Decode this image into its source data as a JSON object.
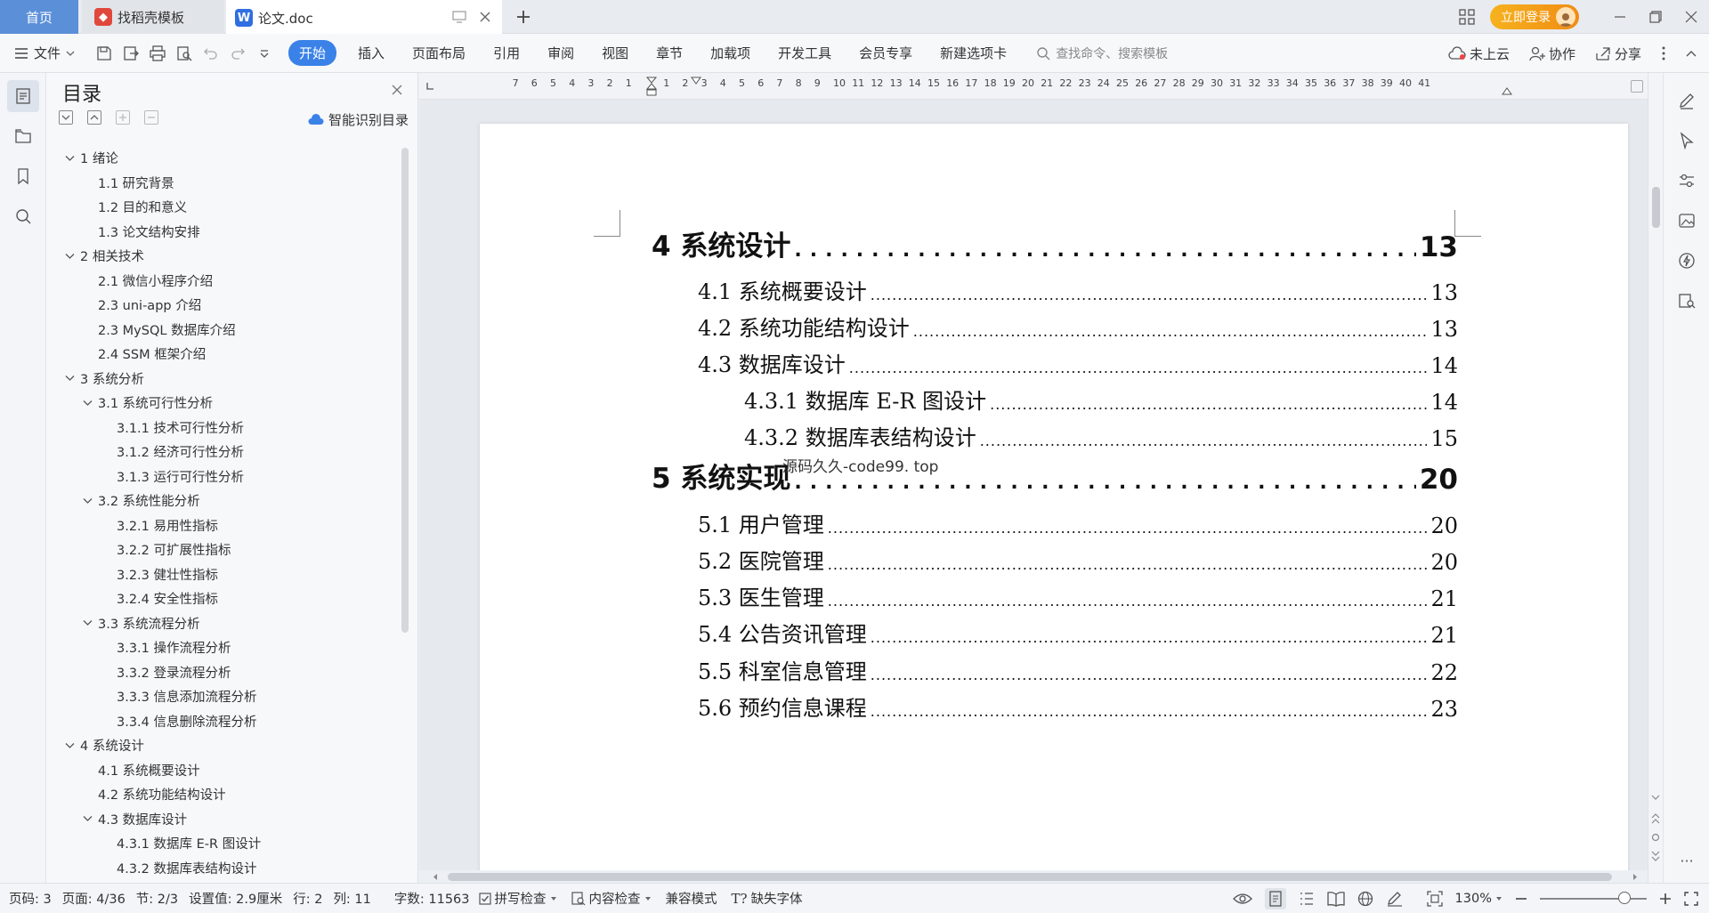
{
  "tabs": {
    "home": "首页",
    "template": "找稻壳模板",
    "doc": "论文.doc"
  },
  "titlebar": {
    "login": "立即登录"
  },
  "ribbon": {
    "file": "文件",
    "menu": [
      "开始",
      "插入",
      "页面布局",
      "引用",
      "审阅",
      "视图",
      "章节",
      "加载项",
      "开发工具",
      "会员专享",
      "新建选项卡"
    ],
    "search_placeholder": "查找命令、搜索模板",
    "cloud": "未上云",
    "collab": "协作",
    "share": "分享"
  },
  "toc_panel": {
    "title": "目录",
    "smart": "智能识别目录",
    "items": [
      {
        "level": 1,
        "text": "1  绪论",
        "expanded": true
      },
      {
        "level": 2,
        "text": "1.1  研究背景"
      },
      {
        "level": 2,
        "text": "1.2  目的和意义"
      },
      {
        "level": 2,
        "text": "1.3  论文结构安排"
      },
      {
        "level": 1,
        "text": "2  相关技术",
        "expanded": true
      },
      {
        "level": 2,
        "text": "2.1  微信小程序介绍"
      },
      {
        "level": 2,
        "text": "2.3 uni-app 介绍"
      },
      {
        "level": 2,
        "text": "2.3 MySQL 数据库介绍"
      },
      {
        "level": 2,
        "text": "2.4 SSM 框架介绍"
      },
      {
        "level": 1,
        "text": "3  系统分析",
        "expanded": true
      },
      {
        "level": 2,
        "text": "3.1  系统可行性分析",
        "expanded": true
      },
      {
        "level": 3,
        "text": "3.1.1  技术可行性分析"
      },
      {
        "level": 3,
        "text": "3.1.2  经济可行性分析"
      },
      {
        "level": 3,
        "text": "3.1.3  运行可行性分析"
      },
      {
        "level": 2,
        "text": "3.2  系统性能分析",
        "expanded": true
      },
      {
        "level": 3,
        "text": "3.2.1  易用性指标"
      },
      {
        "level": 3,
        "text": "3.2.2  可扩展性指标"
      },
      {
        "level": 3,
        "text": "3.2.3  健壮性指标"
      },
      {
        "level": 3,
        "text": "3.2.4  安全性指标"
      },
      {
        "level": 2,
        "text": "3.3  系统流程分析",
        "expanded": true
      },
      {
        "level": 3,
        "text": "3.3.1  操作流程分析"
      },
      {
        "level": 3,
        "text": "3.3.2  登录流程分析"
      },
      {
        "level": 3,
        "text": "3.3.3  信息添加流程分析"
      },
      {
        "level": 3,
        "text": "3.3.4  信息删除流程分析"
      },
      {
        "level": 1,
        "text": "4  系统设计",
        "expanded": true
      },
      {
        "level": 2,
        "text": "4.1  系统概要设计"
      },
      {
        "level": 2,
        "text": "4.2  系统功能结构设计"
      },
      {
        "level": 2,
        "text": "4.3  数据库设计",
        "expanded": true
      },
      {
        "level": 3,
        "text": "4.3.1  数据库 E-R 图设计"
      },
      {
        "level": 3,
        "text": "4.3.2  数据库表结构设计"
      }
    ]
  },
  "ruler": [
    "7",
    "6",
    "5",
    "4",
    "3",
    "2",
    "1",
    "",
    "1",
    "2",
    "3",
    "4",
    "5",
    "6",
    "7",
    "8",
    "9",
    "10",
    "11",
    "12",
    "13",
    "14",
    "15",
    "16",
    "17",
    "18",
    "19",
    "20",
    "21",
    "22",
    "23",
    "24",
    "25",
    "26",
    "27",
    "28",
    "29",
    "30",
    "31",
    "32",
    "33",
    "34",
    "35",
    "36",
    "37",
    "38",
    "39",
    "40",
    "41"
  ],
  "document": {
    "watermark": "源码久久-code99. top",
    "toc": [
      {
        "level": 1,
        "label": "4  系统设计",
        "page": "13"
      },
      {
        "level": 2,
        "label": "4.1  系统概要设计",
        "page": "13"
      },
      {
        "level": 2,
        "label": "4.2  系统功能结构设计",
        "page": "13"
      },
      {
        "level": 2,
        "label": "4.3  数据库设计",
        "page": "14"
      },
      {
        "level": 3,
        "label": "4.3.1  数据库 E-R 图设计",
        "page": "14"
      },
      {
        "level": 3,
        "label": "4.3.2  数据库表结构设计",
        "page": "15"
      },
      {
        "level": 1,
        "label": "5  系统实现",
        "page": "20"
      },
      {
        "level": 2,
        "label": "5.1  用户管理",
        "page": "20"
      },
      {
        "level": 2,
        "label": "5.2  医院管理",
        "page": "20"
      },
      {
        "level": 2,
        "label": "5.3  医生管理",
        "page": "21"
      },
      {
        "level": 2,
        "label": "5.4  公告资讯管理",
        "page": "21"
      },
      {
        "level": 2,
        "label": "5.5  科室信息管理",
        "page": "22"
      },
      {
        "level": 2,
        "label": "5.6  预约信息课程",
        "page": "23"
      }
    ]
  },
  "status": {
    "page_code": "页码: 3",
    "page": "页面: 4/36",
    "section": "节: 2/3",
    "setting": "设置值: 2.9厘米",
    "row": "行: 2",
    "col": "列: 11",
    "words": "字数: 11563",
    "spell": "拼写检查",
    "content_check": "内容检查",
    "compat": "兼容模式",
    "missing_font": "缺失字体",
    "zoom": "130%"
  },
  "colors": {
    "accent": "#3b82e8",
    "home_tab": "#5b8fd8",
    "login": "#f5a318"
  }
}
